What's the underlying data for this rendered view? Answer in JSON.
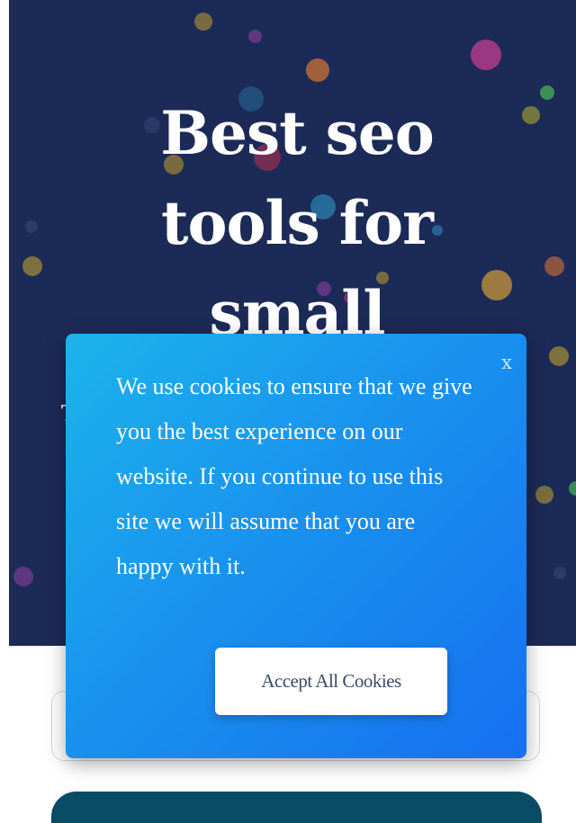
{
  "hero": {
    "title": "Best seo tools for small businesses",
    "subtitle_partial": "T                                                    s",
    "background_color": "#1c2a57"
  },
  "cookie_banner": {
    "message": "We use cookies to ensure that we give you the best experience on our website. If you continue to use this site we will assume that you are happy with it.",
    "close_label": "x",
    "accept_label": "Accept All Cookies",
    "gradient_start": "#1cb3ec",
    "gradient_end": "#1670f0"
  },
  "form": {
    "input_value": "",
    "submit_color": "#0a4b66"
  }
}
